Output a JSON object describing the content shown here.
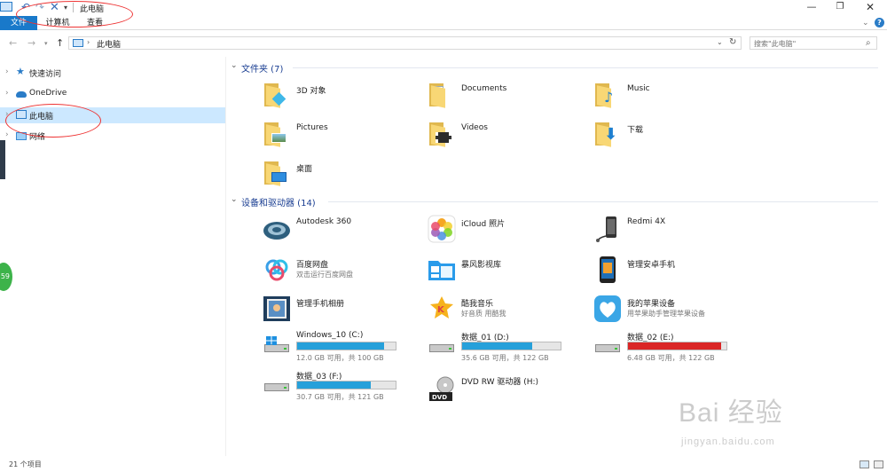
{
  "window": {
    "title": "此电脑",
    "minimize": "—",
    "maximize": "❐",
    "close": "✕"
  },
  "quick_access_toolbar": {
    "undo": "↶",
    "redo": "↷",
    "delete": "✕",
    "dropdown": "▾"
  },
  "ribbon": {
    "tabs": [
      "文件",
      "计算机",
      "查看"
    ],
    "collapse": "⌄",
    "help": "?"
  },
  "address_bar": {
    "back": "←",
    "forward": "→",
    "recent": "▾",
    "up": "↑",
    "separator": "›",
    "path": "此电脑",
    "dropdown": "⌄",
    "refresh": "↻"
  },
  "search": {
    "placeholder": "搜索\"此电脑\"",
    "icon": "⌕"
  },
  "nav_pane": {
    "items": [
      {
        "label": "快速访问",
        "icon": "star-icon",
        "chevron": "›"
      },
      {
        "label": "OneDrive",
        "icon": "cloud-icon",
        "chevron": "›"
      },
      {
        "label": "此电脑",
        "icon": "computer-icon",
        "chevron": "›",
        "selected": true
      },
      {
        "label": "网络",
        "icon": "network-icon",
        "chevron": "›"
      }
    ]
  },
  "folders_group": {
    "chevron": "⌄",
    "header": "文件夹 (7)",
    "items": [
      {
        "label": "3D 对象",
        "icon": "3d-objects-folder-icon"
      },
      {
        "label": "Documents",
        "icon": "documents-folder-icon"
      },
      {
        "label": "Music",
        "icon": "music-folder-icon"
      },
      {
        "label": "Pictures",
        "icon": "pictures-folder-icon"
      },
      {
        "label": "Videos",
        "icon": "videos-folder-icon"
      },
      {
        "label": "下载",
        "icon": "downloads-folder-icon"
      },
      {
        "label": "桌面",
        "icon": "desktop-folder-icon"
      }
    ]
  },
  "devices_group": {
    "chevron": "⌄",
    "header": "设备和驱动器 (14)",
    "devices": [
      {
        "label": "Autodesk 360",
        "sub": "",
        "icon": "autodesk-360-icon"
      },
      {
        "label": "iCloud 照片",
        "sub": "",
        "icon": "icloud-photos-icon"
      },
      {
        "label": "Redmi 4X",
        "sub": "",
        "icon": "phone-icon"
      },
      {
        "label": "百度网盘",
        "sub": "双击运行百度网盘",
        "icon": "baidu-netdisk-icon"
      },
      {
        "label": "暴风影视库",
        "sub": "",
        "icon": "baofeng-video-icon"
      },
      {
        "label": "管理安卓手机",
        "sub": "",
        "icon": "android-phone-icon"
      },
      {
        "label": "管理手机相册",
        "sub": "",
        "icon": "phone-album-icon"
      },
      {
        "label": "酷我音乐",
        "sub": "好音质 用酷我",
        "icon": "kuwo-music-icon"
      },
      {
        "label": "我的苹果设备",
        "sub": "用苹果助手管理苹果设备",
        "icon": "apple-device-icon"
      }
    ],
    "drives": [
      {
        "label": "Windows_10 (C:)",
        "free": "12.0 GB 可用，共 100 GB",
        "used_fraction": 0.88,
        "color": "#26a0da",
        "icon": "windows-drive-icon"
      },
      {
        "label": "数据_01 (D:)",
        "free": "35.6 GB 可用，共 122 GB",
        "used_fraction": 0.71,
        "color": "#26a0da",
        "icon": "hard-drive-icon"
      },
      {
        "label": "数据_02 (E:)",
        "free": "6.48 GB 可用，共 122 GB",
        "used_fraction": 0.95,
        "color": "#da2626",
        "icon": "hard-drive-icon"
      },
      {
        "label": "数据_03 (F:)",
        "free": "30.7 GB 可用，共 121 GB",
        "used_fraction": 0.75,
        "color": "#26a0da",
        "icon": "hard-drive-icon"
      },
      {
        "label": "DVD RW 驱动器 (H:)",
        "free": "",
        "icon": "dvd-drive-icon"
      }
    ]
  },
  "status_bar": {
    "count": "21 个项目"
  },
  "watermark": {
    "brand": "Bai 经验",
    "url": "jingyan.baidu.com"
  },
  "overlay_badge": "59"
}
